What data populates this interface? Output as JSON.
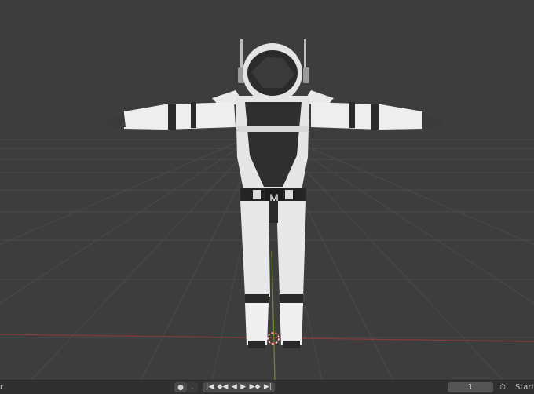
{
  "scene": {
    "emblem_letter": "M"
  },
  "timeline": {
    "left_partial_label": "r",
    "record_icon": "record-dot-icon",
    "keying_dropdown_icon": "chevron-down-icon",
    "playback_controls": [
      {
        "name": "jump-to-start-icon",
        "glyph": "⏮"
      },
      {
        "name": "jump-to-prev-keyframe-icon",
        "glyph": "◆◀"
      },
      {
        "name": "play-reverse-icon",
        "glyph": "◀"
      },
      {
        "name": "play-icon",
        "glyph": "▶"
      },
      {
        "name": "jump-to-next-keyframe-icon",
        "glyph": "▶◆"
      },
      {
        "name": "jump-to-end-icon",
        "glyph": "⏭"
      }
    ],
    "current_frame": "1",
    "start_label": "Start"
  }
}
